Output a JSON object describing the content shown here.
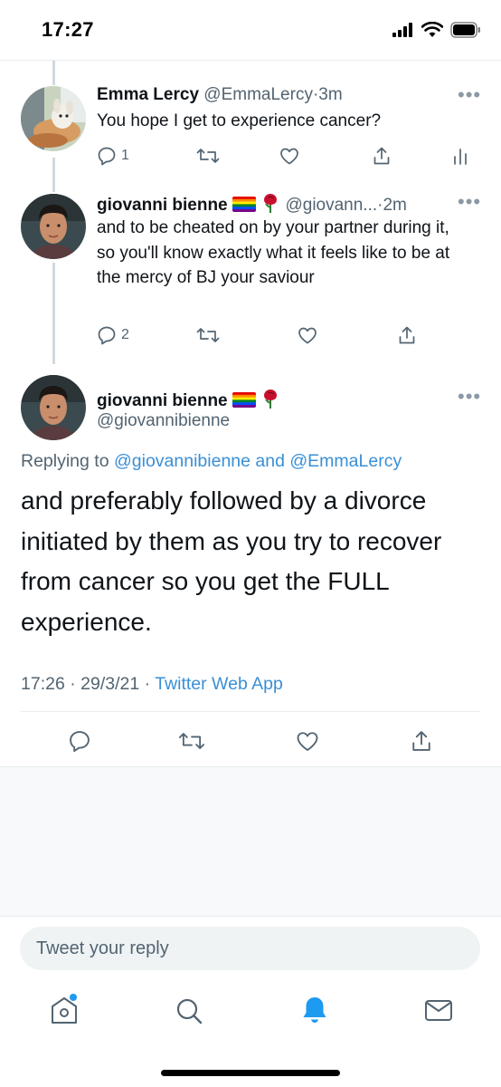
{
  "status_bar": {
    "time": "17:27"
  },
  "tweets": [
    {
      "name": "Emma Lercy",
      "handle": "@EmmaLercy",
      "time": "3m",
      "text": "You hope I get to experience cancer?",
      "reply_count": "1"
    },
    {
      "name": "giovanni bienne",
      "handle": "@giovann...",
      "time": "2m",
      "text": "and to be cheated on by your partner during it, so you'll know exactly what it feels like to be at the mercy of BJ your saviour",
      "reply_count": "2"
    }
  ],
  "main_tweet": {
    "name": "giovanni bienne",
    "handle": "@giovannibienne",
    "replying_prefix": "Replying to",
    "replying_to_1": "@giovannibienne",
    "replying_and": "and",
    "replying_to_2": "@EmmaLercy",
    "text": "and preferably followed by a divorce initiated by them as you try to recover from cancer so you get the FULL experience.",
    "time": "17:26",
    "date": "29/3/21",
    "source": "Twitter Web App"
  },
  "reply": {
    "placeholder": "Tweet your reply"
  },
  "separators": {
    "dot": "·"
  },
  "colors": {
    "accent": "#1d9bf0",
    "rose": "#c8102e",
    "icon_gray": "#536471"
  },
  "icons": [
    "reply-icon",
    "retweet-icon",
    "like-icon",
    "share-icon",
    "analytics-icon",
    "home-icon",
    "search-icon",
    "notifications-icon",
    "messages-icon"
  ]
}
